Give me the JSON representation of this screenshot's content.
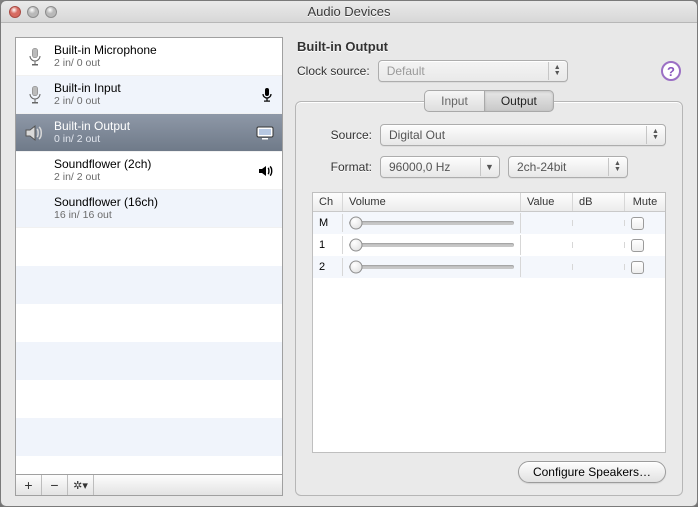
{
  "window": {
    "title": "Audio Devices"
  },
  "devices": [
    {
      "name": "Built-in Microphone",
      "io": "2 in/ 0 out",
      "icon": "mic",
      "selected": false,
      "badge": null
    },
    {
      "name": "Built-in Input",
      "io": "2 in/ 0 out",
      "icon": "mic",
      "selected": false,
      "badge": "mic-solid"
    },
    {
      "name": "Built-in Output",
      "io": "0 in/ 2 out",
      "icon": "speaker",
      "selected": true,
      "badge": "display"
    },
    {
      "name": "Soundflower (2ch)",
      "io": "2 in/ 2 out",
      "icon": null,
      "selected": false,
      "badge": "sound"
    },
    {
      "name": "Soundflower (16ch)",
      "io": "16 in/ 16 out",
      "icon": null,
      "selected": false,
      "badge": null
    }
  ],
  "sidebarTools": {
    "add": "+",
    "remove": "−",
    "settings": "✻"
  },
  "detail": {
    "title": "Built-in Output",
    "clockLabel": "Clock source:",
    "clockValue": "Default",
    "tabs": {
      "input": "Input",
      "output": "Output",
      "active": "Output"
    },
    "sourceLabel": "Source:",
    "sourceValue": "Digital Out",
    "formatLabel": "Format:",
    "formatHz": "96000,0 Hz",
    "formatCh": "2ch-24bit",
    "columns": {
      "ch": "Ch",
      "volume": "Volume",
      "value": "Value",
      "db": "dB",
      "mute": "Mute"
    },
    "channels": [
      {
        "ch": "M",
        "value": "",
        "db": "",
        "mute": false,
        "pos": 0
      },
      {
        "ch": "1",
        "value": "",
        "db": "",
        "mute": false,
        "pos": 0
      },
      {
        "ch": "2",
        "value": "",
        "db": "",
        "mute": false,
        "pos": 0
      }
    ],
    "configureBtn": "Configure Speakers…"
  }
}
